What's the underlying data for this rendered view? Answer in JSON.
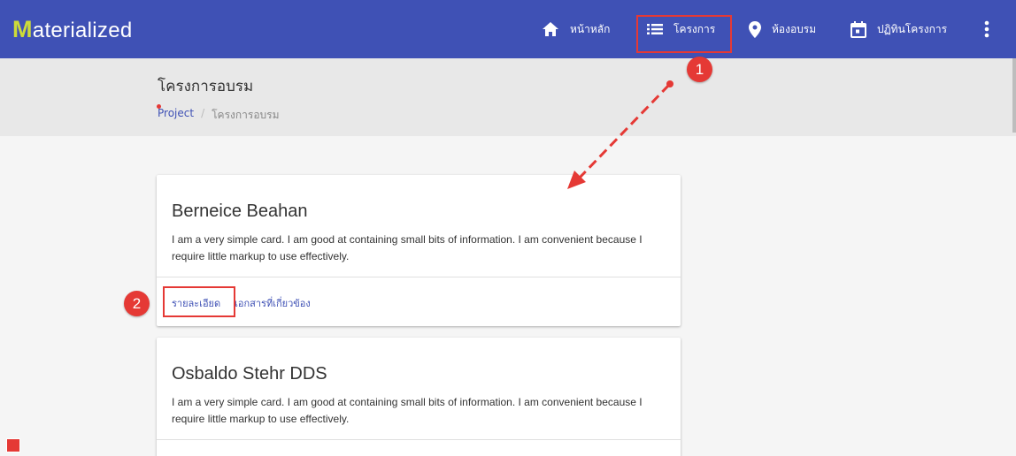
{
  "brand": {
    "first_letter": "M",
    "rest": "aterialized"
  },
  "nav": {
    "home": {
      "label": "หน้าหลัก",
      "icon": "home-icon"
    },
    "projects": {
      "label": "โครงการ",
      "icon": "list-icon"
    },
    "rooms": {
      "label": "ห้องอบรม",
      "icon": "location-pin-icon"
    },
    "calendar": {
      "label": "ปฏิทินโครงการ",
      "icon": "calendar-icon"
    },
    "more": {
      "icon": "more-vert-icon"
    }
  },
  "page": {
    "title": "โครงการอบรม",
    "breadcrumb": {
      "link": "Project",
      "separator": "/",
      "current": "โครงการอบรม"
    }
  },
  "cards": [
    {
      "title": "Berneice Beahan",
      "text": "I am a very simple card. I am good at containing small bits of information. I am convenient because I require little markup to use effectively.",
      "actions": [
        "รายละเอียด",
        "เอกสารที่เกี่ยวข้อง"
      ]
    },
    {
      "title": "Osbaldo Stehr DDS",
      "text": "I am a very simple card. I am good at containing small bits of information. I am convenient because I require little markup to use effectively."
    }
  ],
  "annotations": {
    "step1": "1",
    "step2": "2"
  },
  "colors": {
    "topbar": "#3f51b5",
    "logo_accent": "#cddc39",
    "annotation": "#e53935"
  }
}
